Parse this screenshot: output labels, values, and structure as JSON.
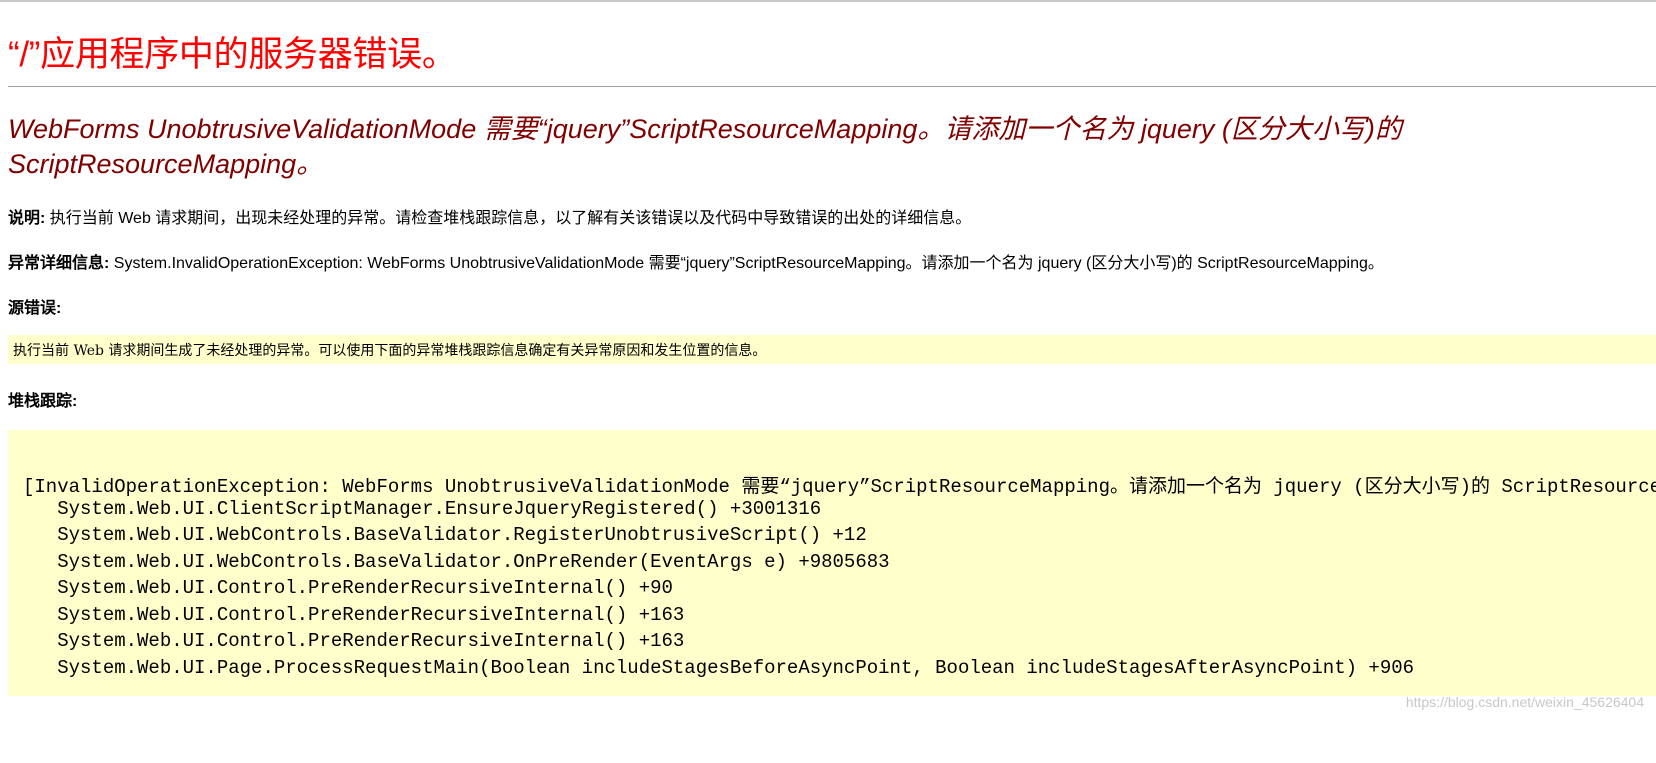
{
  "page": {
    "title": "“/”应用程序中的服务器错误。",
    "error_message": "WebForms UnobtrusiveValidationMode 需要“jquery”ScriptResourceMapping。请添加一个名为 jquery (区分大小写)的 ScriptResourceMapping。"
  },
  "description": {
    "label": "说明:",
    "text": " 执行当前 Web 请求期间，出现未经处理的异常。请检查堆栈跟踪信息，以了解有关该错误以及代码中导致错误的出处的详细信息。"
  },
  "exception_details": {
    "label": "异常详细信息:",
    "text": " System.InvalidOperationException: WebForms UnobtrusiveValidationMode 需要“jquery”ScriptResourceMapping。请添加一个名为 jquery (区分大小写)的 ScriptResourceMapping。"
  },
  "source_error": {
    "label": "源错误:",
    "text": "执行当前 Web 请求期间生成了未经处理的异常。可以使用下面的异常堆栈跟踪信息确定有关异常原因和发生位置的信息。"
  },
  "stack_trace": {
    "label": "堆栈跟踪:",
    "lines": [
      "[InvalidOperationException: WebForms UnobtrusiveValidationMode 需要“jquery”ScriptResourceMapping。请添加一个名为 jquery (区分大小写)的 ScriptResourceMapping。]",
      "   System.Web.UI.ClientScriptManager.EnsureJqueryRegistered() +3001316",
      "   System.Web.UI.WebControls.BaseValidator.RegisterUnobtrusiveScript() +12",
      "   System.Web.UI.WebControls.BaseValidator.OnPreRender(EventArgs e) +9805683",
      "   System.Web.UI.Control.PreRenderRecursiveInternal() +90",
      "   System.Web.UI.Control.PreRenderRecursiveInternal() +163",
      "   System.Web.UI.Control.PreRenderRecursiveInternal() +163",
      "   System.Web.UI.Page.ProcessRequestMain(Boolean includeStagesBeforeAsyncPoint, Boolean includeStagesAfterAsyncPoint) +906"
    ]
  },
  "watermark": "https://blog.csdn.net/weixin_45626404",
  "colors": {
    "title": "#ff0000",
    "error_message": "#800000",
    "code_background": "#ffffcc"
  }
}
